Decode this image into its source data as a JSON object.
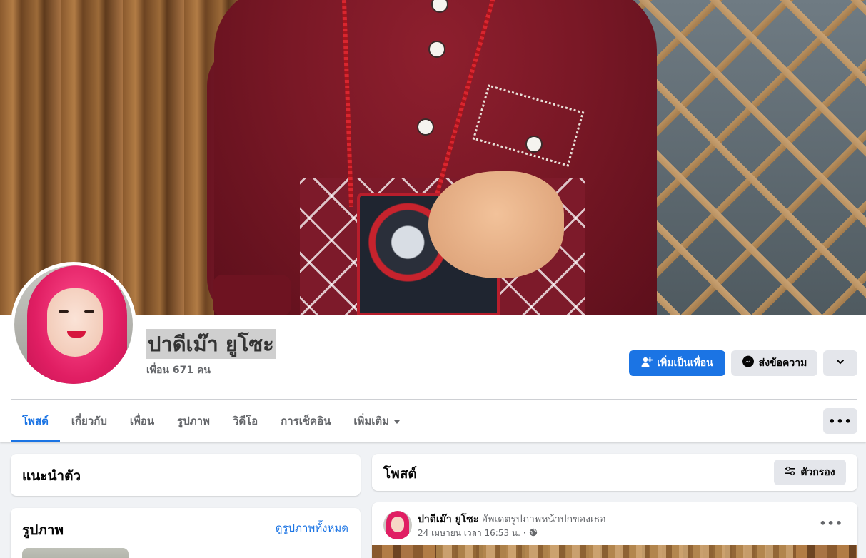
{
  "profile": {
    "name": "ปาดีเม๊า ยูโซะ",
    "friends": "เพื่อน 671 คน"
  },
  "actions": {
    "add_friend": "เพิ่มเป็นเพื่อน",
    "message": "ส่งข้อความ"
  },
  "tabs": [
    {
      "label": "โพสต์",
      "active": true
    },
    {
      "label": "เกี่ยวกับ"
    },
    {
      "label": "เพื่อน"
    },
    {
      "label": "รูปภาพ"
    },
    {
      "label": "วิดีโอ"
    },
    {
      "label": "การเช็คอิน"
    },
    {
      "label": "เพิ่มเติม"
    }
  ],
  "intro": {
    "title": "แนะนำตัว"
  },
  "photos": {
    "title": "รูปภาพ",
    "see_all": "ดูรูปภาพทั้งหมด"
  },
  "posts": {
    "title": "โพสต์",
    "filter": "ตัวกรอง"
  },
  "post": {
    "author": "ปาดีเม๊า ยูโซะ",
    "action": "อัพเดตรูปภาพหน้าปกของเธอ",
    "time": "24 เมษายน เวลา 16:53 น. ·"
  },
  "colors": {
    "accent": "#1b74e4",
    "button_gray": "#e4e6eb",
    "page_bg": "#f0f2f5"
  },
  "icons": [
    "add-friend-icon",
    "messenger-icon",
    "chevron-down-icon",
    "more-icon",
    "filter-icon",
    "globe-icon",
    "caret-down-icon"
  ]
}
